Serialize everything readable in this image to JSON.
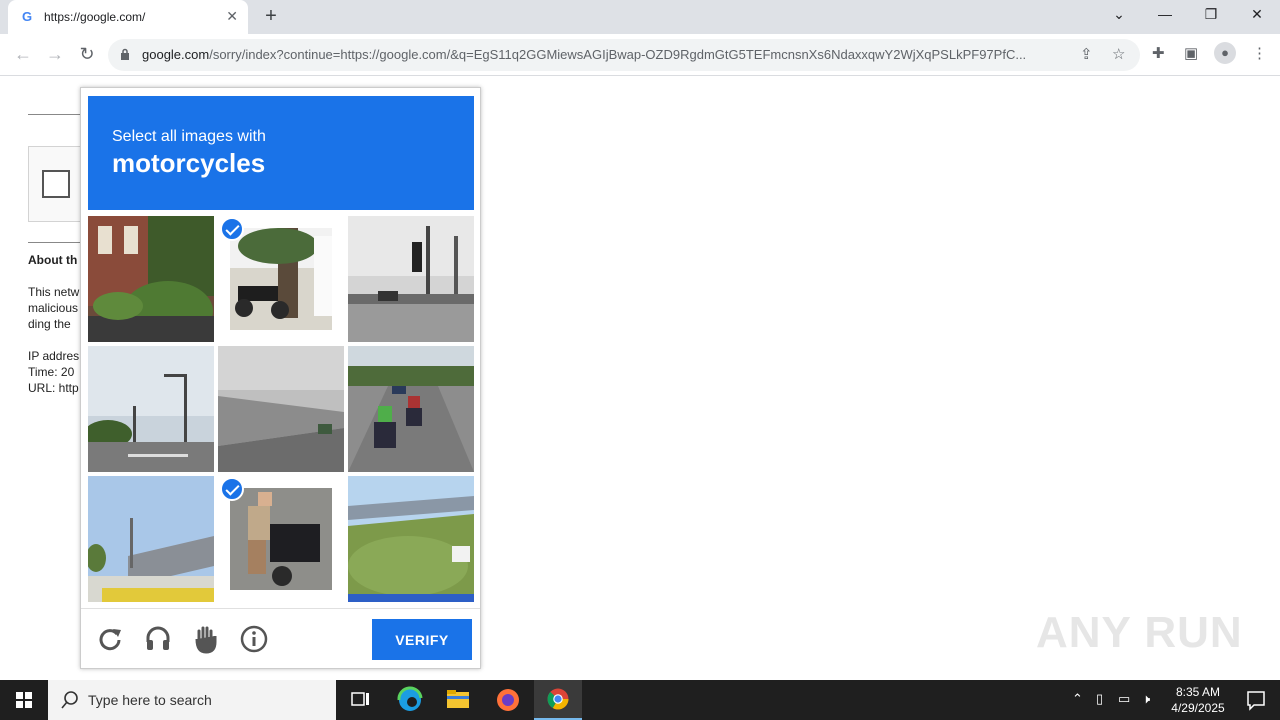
{
  "browser": {
    "tab_title": "https://google.com/",
    "tab_favicon": "G",
    "tab_close": "✕",
    "new_tab": "+",
    "url_host": "google.com",
    "url_rest": "/sorry/index?continue=https://google.com/&q=EgS11q2GGMiewsAGIjBwap-OZD9RgdmGtG5TEFmcnsnXs6NdaxxqwY2WjXqPSLkPF97PfC...",
    "window_controls": {
      "tablist": "⌄",
      "minimize": "—",
      "restore": "❐",
      "close": "✕"
    }
  },
  "page": {
    "about_text": "About th",
    "body_lines": [
      "This netw",
      "malicious",
      "ding the"
    ],
    "ip_line": "IP addres",
    "time_line": "Time: 20",
    "url_line": "URL: http"
  },
  "captcha": {
    "instruction": "Select all images with",
    "target": "motorcycles",
    "tiles": [
      {
        "id": 1,
        "subject": "brick house with plants",
        "selected": false
      },
      {
        "id": 2,
        "subject": "motorcycle parked under tree",
        "selected": true
      },
      {
        "id": 3,
        "subject": "street intersection with traffic light",
        "selected": false
      },
      {
        "id": 4,
        "subject": "road with street lamps",
        "selected": false
      },
      {
        "id": 5,
        "subject": "highway with concrete wall",
        "selected": false
      },
      {
        "id": 6,
        "subject": "motorcycles on highway",
        "selected": false
      },
      {
        "id": 7,
        "subject": "overpass bridge",
        "selected": false
      },
      {
        "id": 8,
        "subject": "person on scooter",
        "selected": true
      },
      {
        "id": 9,
        "subject": "grass embankment with bridge",
        "selected": false
      }
    ],
    "verify_label": "VERIFY",
    "footer_icons": [
      "reload-icon",
      "audio-icon",
      "hand-icon",
      "info-icon"
    ]
  },
  "watermark": "ANY RUN",
  "taskbar": {
    "search_placeholder": "Type here to search",
    "time": "8:35 AM",
    "date": "4/29/2025"
  },
  "colors": {
    "accent": "#1a73e8",
    "taskbar": "#1f1f1f"
  }
}
